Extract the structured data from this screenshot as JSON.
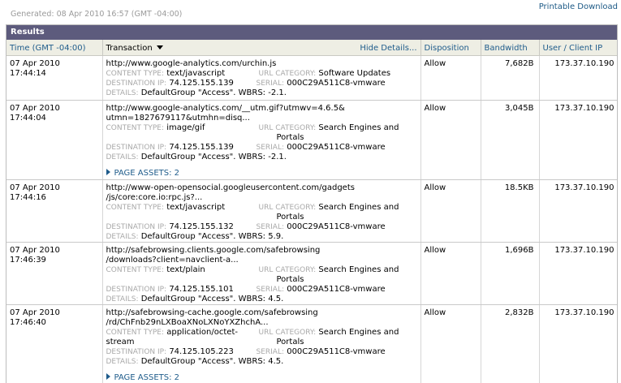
{
  "header": {
    "generated": "Generated: 08 Apr 2010 16:57 (GMT -04:00)",
    "printable_download": "Printable Download"
  },
  "panel": {
    "title": "Results"
  },
  "columns": {
    "time": "Time (GMT -04:00)",
    "transaction": "Transaction",
    "hide_details": "Hide Details...",
    "disposition": "Disposition",
    "bandwidth": "Bandwidth",
    "user_ip": "User / Client IP"
  },
  "labels": {
    "content_type": "CONTENT TYPE:",
    "url_category": "URL CATEGORY:",
    "destination_ip": "DESTINATION IP:",
    "serial": "SERIAL:",
    "details": "DETAILS:"
  },
  "rows": [
    {
      "time": "07 Apr 2010 17:44:14",
      "url1": "http://www.google-analytics.com/urchin.js",
      "url2": "",
      "content_type": "text/javascript",
      "content_type2": "",
      "category": "Software Updates",
      "category2": "",
      "dest_ip": "74.125.155.139",
      "serial": "000C29A511C8-vmware",
      "details": "DefaultGroup \"Access\". WBRS: -2.1.",
      "assets": "",
      "disposition": "Allow",
      "bandwidth": "7,682B",
      "ip": "173.37.10.190"
    },
    {
      "time": "07 Apr 2010 17:44:04",
      "url1": "http://www.google-analytics.com/__utm.gif?utmwv=4.6.5&",
      "url2": "utmn=1827679117&utmhn=disq...",
      "content_type": "image/gif",
      "content_type2": "",
      "category": "Search Engines and",
      "category2": "Portals",
      "dest_ip": "74.125.155.139",
      "serial": "000C29A511C8-vmware",
      "details": "DefaultGroup \"Access\". WBRS: -2.1.",
      "assets": "PAGE ASSETS: 2",
      "disposition": "Allow",
      "bandwidth": "3,045B",
      "ip": "173.37.10.190"
    },
    {
      "time": "07 Apr 2010 17:44:16",
      "url1": "http://www-open-opensocial.googleusercontent.com/gadgets",
      "url2": "/js/core:core.io:rpc.js?...",
      "content_type": "text/javascript",
      "content_type2": "",
      "category": "Search Engines and",
      "category2": "Portals",
      "dest_ip": "74.125.155.132",
      "serial": "000C29A511C8-vmware",
      "details": "DefaultGroup \"Access\". WBRS: 5.9.",
      "assets": "",
      "disposition": "Allow",
      "bandwidth": "18.5KB",
      "ip": "173.37.10.190"
    },
    {
      "time": "07 Apr 2010 17:46:39",
      "url1": "http://safebrowsing.clients.google.com/safebrowsing",
      "url2": "/downloads?client=navclient-a...",
      "content_type": "text/plain",
      "content_type2": "",
      "category": "Search Engines and",
      "category2": "Portals",
      "dest_ip": "74.125.155.101",
      "serial": "000C29A511C8-vmware",
      "details": "DefaultGroup \"Access\". WBRS: 4.5.",
      "assets": "",
      "disposition": "Allow",
      "bandwidth": "1,696B",
      "ip": "173.37.10.190"
    },
    {
      "time": "07 Apr 2010 17:46:40",
      "url1": "http://safebrowsing-cache.google.com/safebrowsing",
      "url2": "/rd/ChFnb29nLXBoaXNoLXNoYXZhchA...",
      "content_type": "application/octet-",
      "content_type2": "stream",
      "category": "Search Engines and",
      "category2": "Portals",
      "dest_ip": "74.125.105.223",
      "serial": "000C29A511C8-vmware",
      "details": "DefaultGroup \"Access\". WBRS: 4.5.",
      "assets": "PAGE ASSETS: 2",
      "disposition": "Allow",
      "bandwidth": "2,832B",
      "ip": "173.37.10.190"
    }
  ]
}
